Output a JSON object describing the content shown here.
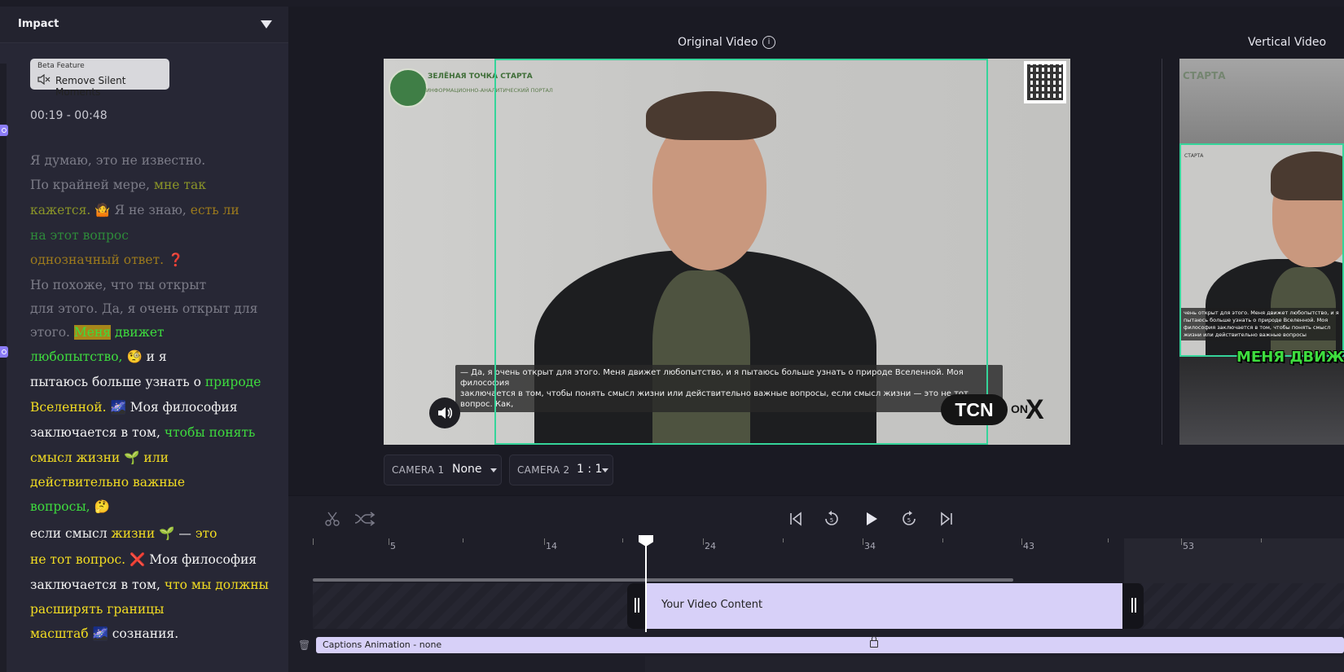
{
  "panel": {
    "title": "Impact",
    "beta_label": "Beta Feature",
    "remove_silent": "Remove Silent Moments",
    "time_range": "00:19 - 00:48"
  },
  "transcript": {
    "l1": "Я думаю, это не известно.",
    "l2a": "По крайней мере, ",
    "l2b": "мне так",
    "l3a": "кажется.",
    "l3e": "🤷",
    "l3b": " Я не знаю, ",
    "l3c": "есть ли",
    "l4": "на этот вопрос",
    "l5a": "однозначный ответ.",
    "l5e": "❓",
    "l6": "Но похоже, что ты открыт",
    "l7": "для этого. Да, я очень открыт для",
    "l8a": "этого. ",
    "l8b": "Меня",
    "l8c": " движет",
    "l9a": "любопытство,",
    "l9e": "🧐",
    "l9b": " и я",
    "l10a": "пытаюсь больше узнать о ",
    "l10b": "природе",
    "l11a": "Вселенной.",
    "l11e": "🌌",
    "l11b": " Моя философия",
    "l12a": "заключается в том, ",
    "l12b": "чтобы понять",
    "l13a": "смысл жизни",
    "l13e": "🌱",
    "l13b": " или",
    "l14": "действительно важные",
    "l15a": "вопросы,",
    "l15e": "🤔",
    "l16a": "если смысл ",
    "l16b": "жизни",
    "l16e": "🌱",
    "l16c": " — ",
    "l16d": "это",
    "l17a": "не тот вопрос.",
    "l17e": "❌",
    "l17b": " Моя философия",
    "l18a": "заключается в том, ",
    "l18b": "что мы должны",
    "l19": "расширять границы",
    "l20a": "масштаб",
    "l20e": "🌌",
    "l20b": " сознания."
  },
  "video": {
    "original_label": "Original Video",
    "vertical_label": "Vertical Video",
    "logo_title": "ЗЕЛЁНАЯ ТОЧКА СТАРТА",
    "logo_sub": "ИНФОРМАЦИОННО-АНАЛИТИЧЕСКИЙ ПОРТАЛ",
    "subtitle_line1": "— Да, я очень открыт для этого. Меня движет любопытство, и я пытаюсь больше узнать о природе Вселенной. Моя философия",
    "subtitle_line2": "заключается в том, чтобы понять смысл жизни или действительно важные вопросы, если смысл жизни — это не тот вопрос. Как,",
    "tcn": "TCN",
    "tcn_on": "ON",
    "tcn_x": "X",
    "vertical_caption": "МЕНЯ ДВИЖЕТ",
    "vertical_small": "СТАРТА",
    "vertical_sub": "чень открыт для этого. Меня движет любопытство, и я пытаюсь больше узнать о природе Вселенной. Моя философия заключается в том, чтобы понять смысл жизни или действительно важные вопросы"
  },
  "cameras": {
    "cam1_label": "CAMERA 1",
    "cam1_value": "None",
    "cam2_label": "CAMERA 2",
    "cam2_value": "1 : 1"
  },
  "timeline": {
    "ticks": [
      "5",
      "14",
      "24",
      "34",
      "43",
      "53"
    ],
    "clip_label": "Your Video Content",
    "captions_label": "Captions Animation - none"
  },
  "colors": {
    "accent_green": "#35d49a",
    "clip": "#d7d0f8",
    "marker": "#8b7cf6"
  }
}
